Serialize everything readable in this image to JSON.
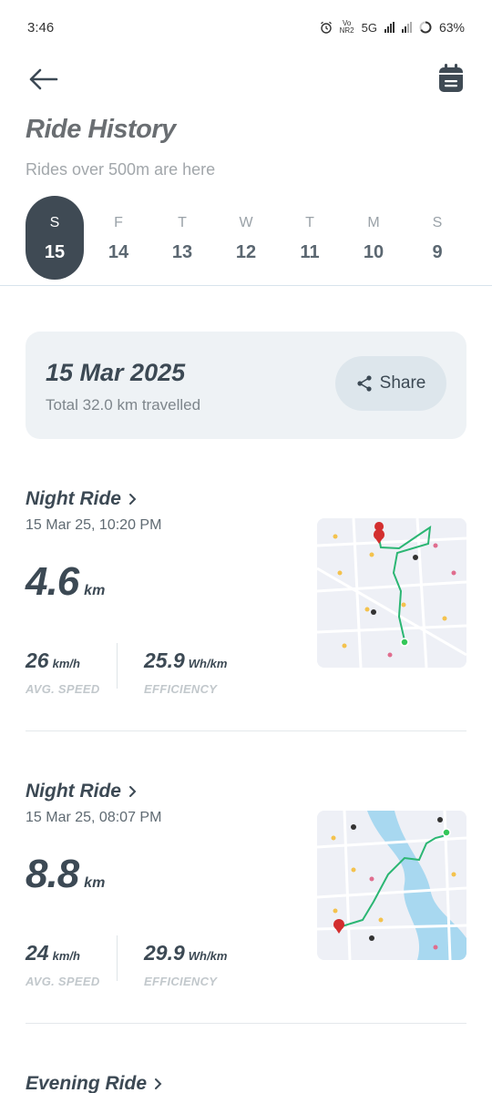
{
  "status": {
    "time": "3:46",
    "network": "5G",
    "volte_line1": "Vo",
    "volte_line2": "NR2",
    "battery": "63%"
  },
  "header": {
    "title": "Ride History",
    "subtitle": "Rides over 500m are here"
  },
  "days": [
    {
      "label": "S",
      "num": "15",
      "active": true
    },
    {
      "label": "F",
      "num": "14"
    },
    {
      "label": "T",
      "num": "13"
    },
    {
      "label": "W",
      "num": "12"
    },
    {
      "label": "T",
      "num": "11"
    },
    {
      "label": "M",
      "num": "10"
    },
    {
      "label": "S",
      "num": "9"
    }
  ],
  "summary": {
    "date": "15 Mar 2025",
    "total": "Total 32.0 km travelled",
    "share_label": "Share"
  },
  "rides": [
    {
      "title": "Night Ride",
      "time": "15 Mar 25, 10:20 PM",
      "distance": "4.6",
      "distance_unit": "km",
      "speed": "26",
      "speed_unit": "km/h",
      "speed_label": "AVG. SPEED",
      "efficiency": "25.9",
      "efficiency_unit": "Wh/km",
      "efficiency_label": "EFFICIENCY"
    },
    {
      "title": "Night Ride",
      "time": "15 Mar 25, 08:07 PM",
      "distance": "8.8",
      "distance_unit": "km",
      "speed": "24",
      "speed_unit": "km/h",
      "speed_label": "AVG. SPEED",
      "efficiency": "29.9",
      "efficiency_unit": "Wh/km",
      "efficiency_label": "EFFICIENCY"
    },
    {
      "title": "Evening Ride"
    }
  ],
  "colors": {
    "primary": "#3f4a54",
    "route": "#2bb673",
    "start_pin": "#d32f2f",
    "end_pin": "#34c759"
  }
}
